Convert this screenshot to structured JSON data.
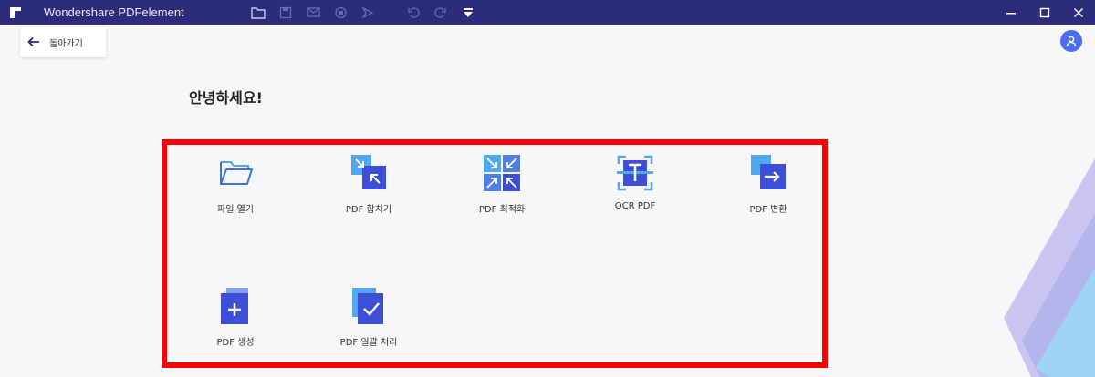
{
  "titlebar": {
    "app_title": "Wondershare PDFelement",
    "tools": [
      "folder-icon",
      "save-icon",
      "mail-icon",
      "print-icon",
      "cursor-icon",
      "undo-icon",
      "redo-icon",
      "dropdown-icon"
    ],
    "window_controls": [
      "minimize",
      "maximize",
      "close"
    ],
    "background_color": "#2b2c7a"
  },
  "back": {
    "label": "돌아가기"
  },
  "greeting": "안녕하세요!",
  "tools": [
    {
      "label": "파일 열기",
      "icon": "open-folder-icon"
    },
    {
      "label": "PDF 합치기",
      "icon": "combine-pdf-icon"
    },
    {
      "label": "PDF 최적화",
      "icon": "optimize-pdf-icon"
    },
    {
      "label": "OCR PDF",
      "icon": "ocr-pdf-icon"
    },
    {
      "label": "PDF 변환",
      "icon": "convert-pdf-icon"
    },
    {
      "label": "PDF 생성",
      "icon": "create-pdf-icon"
    },
    {
      "label": "PDF 일괄 처리",
      "icon": "batch-pdf-icon"
    }
  ],
  "colors": {
    "accent": "#4a6cf7",
    "highlight_border": "#ff0000",
    "icon_primary": "#3d4fd6",
    "icon_secondary": "#4fa8f0"
  }
}
